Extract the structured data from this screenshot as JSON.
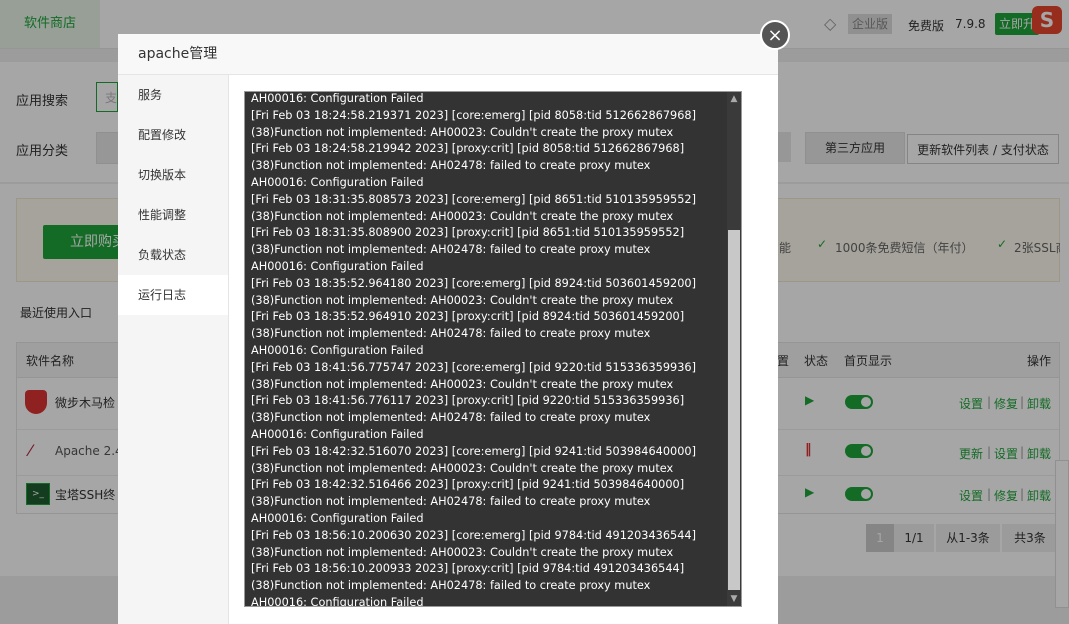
{
  "background": {
    "top_tab": "软件商店",
    "enterprise_label": "企业版",
    "free_label": "免费版",
    "version": "7.9.8",
    "upgrade_button": "立即升",
    "search_label": "应用搜索",
    "search_placeholder": "支",
    "category_label": "应用分类",
    "third_party_button": "第三方应用",
    "update_list_button": "更新软件列表 / 支付状态",
    "buy_button": "立即购买",
    "feature_1": "能",
    "feature_2": "1000条免费短信（年付）",
    "feature_3": "2张SSL商",
    "recent_label": "最近使用入口",
    "table": {
      "col_name": "软件名称",
      "col_position": "置",
      "col_status": "状态",
      "col_home": "首页显示",
      "col_ops": "操作",
      "rows": [
        {
          "name": "微步木马检",
          "ops": [
            "设置",
            "修复",
            "卸载"
          ]
        },
        {
          "name": "Apache 2.4",
          "ops": [
            "更新",
            "设置",
            "卸载"
          ]
        },
        {
          "name": "宝塔SSH终",
          "ops": [
            "设置",
            "修复",
            "卸载"
          ]
        }
      ]
    },
    "pagination": {
      "current": "1",
      "pages": "1/1",
      "range": "从1-3条",
      "total": "共3条"
    }
  },
  "modal": {
    "title": "apache管理",
    "close": "×",
    "nav": [
      {
        "label": "服务"
      },
      {
        "label": "配置修改"
      },
      {
        "label": "切换版本"
      },
      {
        "label": "性能调整"
      },
      {
        "label": "负载状态"
      },
      {
        "label": "运行日志"
      }
    ],
    "active_nav": 5,
    "log_lines": [
      "AH00016: Configuration Failed",
      "[Fri Feb 03 18:24:58.219371 2023] [core:emerg] [pid 8058:tid 512662867968]",
      "(38)Function not implemented: AH00023: Couldn't create the proxy mutex",
      "[Fri Feb 03 18:24:58.219942 2023] [proxy:crit] [pid 8058:tid 512662867968]",
      "(38)Function not implemented: AH02478: failed to create proxy mutex",
      "AH00016: Configuration Failed",
      "[Fri Feb 03 18:31:35.808573 2023] [core:emerg] [pid 8651:tid 510135959552]",
      "(38)Function not implemented: AH00023: Couldn't create the proxy mutex",
      "[Fri Feb 03 18:31:35.808900 2023] [proxy:crit] [pid 8651:tid 510135959552]",
      "(38)Function not implemented: AH02478: failed to create proxy mutex",
      "AH00016: Configuration Failed",
      "[Fri Feb 03 18:35:52.964180 2023] [core:emerg] [pid 8924:tid 503601459200]",
      "(38)Function not implemented: AH00023: Couldn't create the proxy mutex",
      "[Fri Feb 03 18:35:52.964910 2023] [proxy:crit] [pid 8924:tid 503601459200]",
      "(38)Function not implemented: AH02478: failed to create proxy mutex",
      "AH00016: Configuration Failed",
      "[Fri Feb 03 18:41:56.775747 2023] [core:emerg] [pid 9220:tid 515336359936]",
      "(38)Function not implemented: AH00023: Couldn't create the proxy mutex",
      "[Fri Feb 03 18:41:56.776117 2023] [proxy:crit] [pid 9220:tid 515336359936]",
      "(38)Function not implemented: AH02478: failed to create proxy mutex",
      "AH00016: Configuration Failed",
      "[Fri Feb 03 18:42:32.516070 2023] [core:emerg] [pid 9241:tid 503984640000]",
      "(38)Function not implemented: AH00023: Couldn't create the proxy mutex",
      "[Fri Feb 03 18:42:32.516466 2023] [proxy:crit] [pid 9241:tid 503984640000]",
      "(38)Function not implemented: AH02478: failed to create proxy mutex",
      "AH00016: Configuration Failed",
      "[Fri Feb 03 18:56:10.200630 2023] [core:emerg] [pid 9784:tid 491203436544]",
      "(38)Function not implemented: AH00023: Couldn't create the proxy mutex",
      "[Fri Feb 03 18:56:10.200933 2023] [proxy:crit] [pid 9784:tid 491203436544]",
      "(38)Function not implemented: AH02478: failed to create proxy mutex",
      "AH00016: Configuration Failed"
    ]
  },
  "colors": {
    "accent": "#20a53a",
    "log_bg": "#333333",
    "danger": "#e8452c"
  }
}
